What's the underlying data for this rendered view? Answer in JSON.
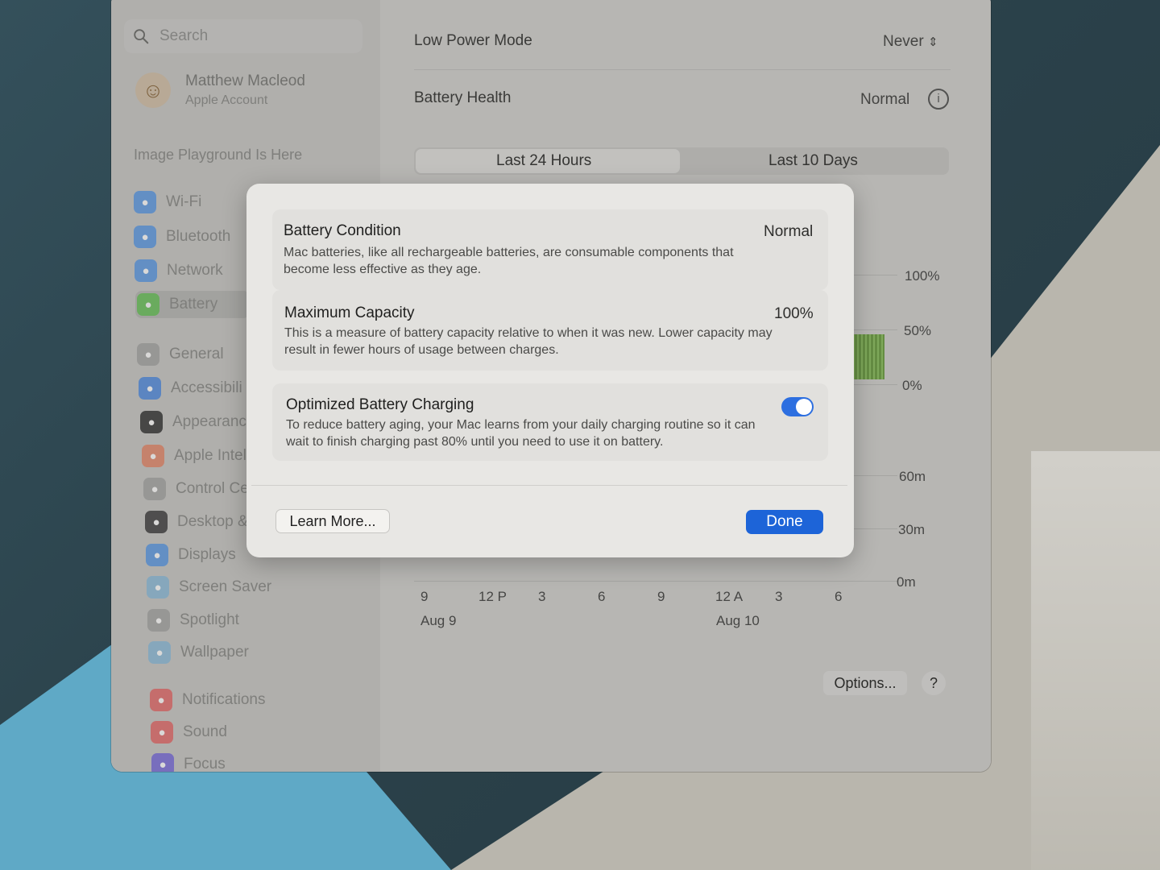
{
  "sidebar": {
    "search_placeholder": "Search",
    "account_name": "Matthew Macleod",
    "account_sub": "Apple Account",
    "promo": "Image Playground Is Here",
    "items": [
      {
        "label": "Wi-Fi",
        "icon": "wifi-icon",
        "color": "#4a8fe0"
      },
      {
        "label": "Bluetooth",
        "icon": "bluetooth-icon",
        "color": "#4a8fe0"
      },
      {
        "label": "Network",
        "icon": "globe-icon",
        "color": "#4a8fe0"
      },
      {
        "label": "Battery",
        "icon": "battery-icon",
        "color": "#5cbf4a"
      },
      {
        "label": "General",
        "icon": "gear-icon",
        "color": "#9a9a98"
      },
      {
        "label": "Accessibili",
        "icon": "accessibility-icon",
        "color": "#3d7fdd"
      },
      {
        "label": "Appearanc",
        "icon": "appearance-icon",
        "color": "#1f1f1f"
      },
      {
        "label": "Apple Intel",
        "icon": "apple-intelligence-icon",
        "color": "#e07a5a"
      },
      {
        "label": "Control Ce",
        "icon": "control-center-icon",
        "color": "#9a9a98"
      },
      {
        "label": "Desktop &",
        "icon": "desktop-dock-icon",
        "color": "#2a2a2a"
      },
      {
        "label": "Displays",
        "icon": "displays-icon",
        "color": "#4a8fe0"
      },
      {
        "label": "Screen Saver",
        "icon": "screen-saver-icon",
        "color": "#7fb3d6"
      },
      {
        "label": "Spotlight",
        "icon": "spotlight-icon",
        "color": "#9a9a98"
      },
      {
        "label": "Wallpaper",
        "icon": "wallpaper-icon",
        "color": "#7fb3d6"
      },
      {
        "label": "Notifications",
        "icon": "notifications-icon",
        "color": "#e05a5a"
      },
      {
        "label": "Sound",
        "icon": "sound-icon",
        "color": "#e05a5a"
      },
      {
        "label": "Focus",
        "icon": "focus-icon",
        "color": "#6a5ad6"
      }
    ]
  },
  "main": {
    "low_power_label": "Low Power Mode",
    "low_power_value": "Never",
    "battery_health_label": "Battery Health",
    "battery_health_value": "Normal",
    "tabs": [
      "Last 24 Hours",
      "Last 10 Days"
    ],
    "level_axis": [
      "100%",
      "50%",
      "0%"
    ],
    "usage_axis": [
      "60m",
      "30m",
      "0m"
    ],
    "time_ticks": [
      "9",
      "12 P",
      "3",
      "6",
      "9",
      "12 A",
      "3",
      "6"
    ],
    "dates": [
      "Aug 9",
      "Aug 10"
    ],
    "options_label": "Options...",
    "help_label": "?"
  },
  "modal": {
    "condition_title": "Battery Condition",
    "condition_value": "Normal",
    "condition_desc": "Mac batteries, like all rechargeable batteries, are consumable components that become less effective as they age.",
    "capacity_title": "Maximum Capacity",
    "capacity_value": "100%",
    "capacity_desc": "This is a measure of battery capacity relative to when it was new. Lower capacity may result in fewer hours of usage between charges.",
    "optimized_title": "Optimized Battery Charging",
    "optimized_on": true,
    "optimized_desc": "To reduce battery aging, your Mac learns from your daily charging routine so it can wait to finish charging past 80% until you need to use it on battery.",
    "learn_more": "Learn More...",
    "done": "Done"
  },
  "colors": {
    "accent": "#1d64d8",
    "toggle_on": "#2d6fe0",
    "battery_bar": "#7aa855"
  }
}
